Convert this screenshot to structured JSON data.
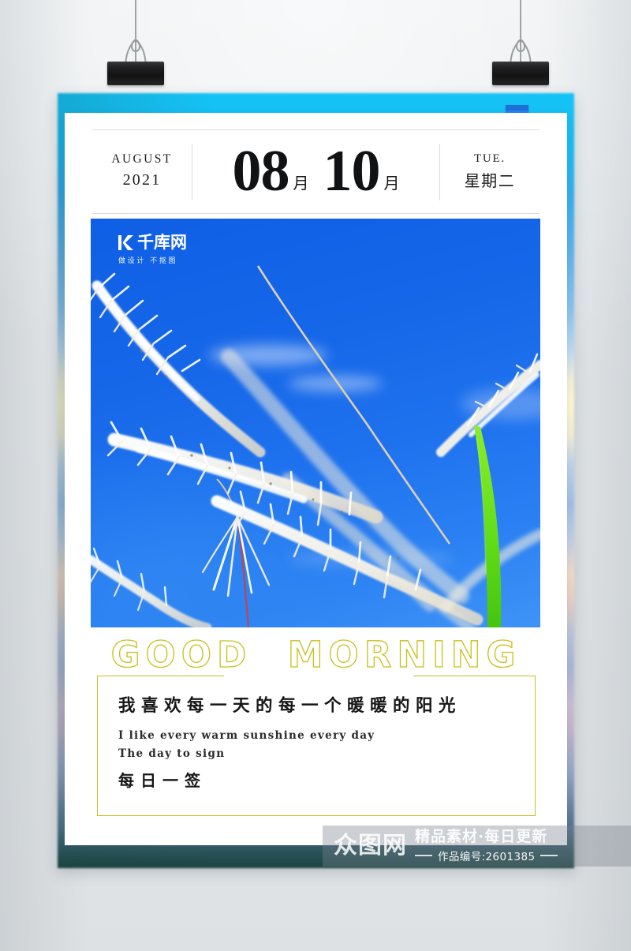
{
  "poster": {
    "header": {
      "month_name": "AUGUST",
      "year": "2021",
      "month_number": "08",
      "month_unit": "月",
      "day_number": "10",
      "day_unit": "月",
      "weekday_en": "TUE.",
      "weekday_cn": "星期二"
    },
    "photo": {
      "alt": "white reed grass plumes against a deep blue sky with one green blade",
      "watermark": {
        "brand": "千库网",
        "tagline": "做设计  不抠图",
        "mark_icon": "qianku-logo-icon"
      }
    },
    "title": "GOOD  MORNING",
    "quote": {
      "cn_main": "我喜欢每一天的每一个暖暖的阳光",
      "en_line1": "I like every warm sunshine every day",
      "en_line2": "The day to sign",
      "cn_sub": "每日一签"
    },
    "site_watermark": {
      "logo": "众图网",
      "tagline": "精品素材·每日更新",
      "code": "作品编号:2601385"
    }
  },
  "colors": {
    "ribbon_blue": "#2583f4",
    "accent_olive": "#c9bf1b",
    "photo_blue": "#1566e8",
    "card_white": "#ffffff"
  },
  "decor": {
    "clip_left_icon": "binder-clip-icon",
    "clip_right_icon": "binder-clip-icon"
  }
}
